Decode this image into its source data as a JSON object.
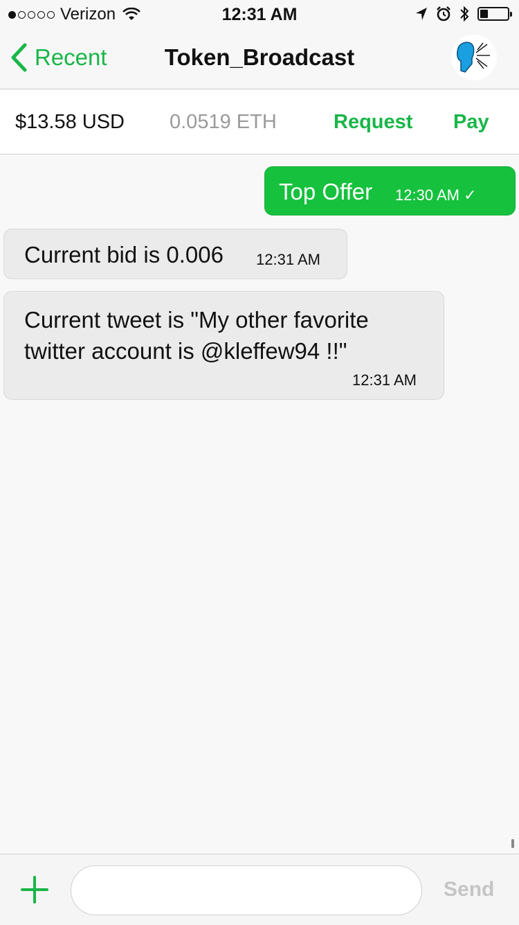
{
  "status_bar": {
    "carrier": "Verizon",
    "time": "12:31 AM",
    "signal_bars_filled": 1,
    "signal_bars_total": 5,
    "battery_level": 0.3
  },
  "nav": {
    "back_label": "Recent",
    "title": "Token_Broadcast"
  },
  "wallet": {
    "usd_balance": "$13.58 USD",
    "eth_balance": "0.0519 ETH",
    "request_label": "Request",
    "pay_label": "Pay"
  },
  "messages": [
    {
      "direction": "sent",
      "text": "Top Offer",
      "time": "12:30 AM ✓"
    },
    {
      "direction": "received",
      "text": "Current bid is 0.006",
      "time": "12:31 AM"
    },
    {
      "direction": "received",
      "text": "Current tweet is \"My other favorite twitter account is @kleffew94 !!\"",
      "time": "12:31 AM"
    }
  ],
  "composer": {
    "input_value": "",
    "send_label": "Send"
  },
  "colors": {
    "accent": "#19b648",
    "sent_bubble": "#15c13d",
    "received_bubble": "#ebebeb"
  }
}
